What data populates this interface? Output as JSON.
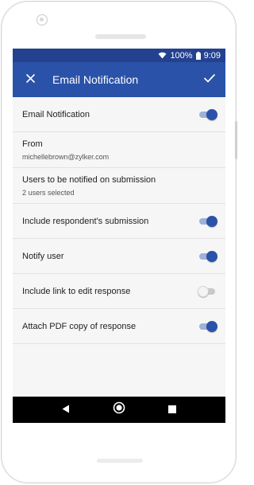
{
  "status_bar": {
    "battery_percent": "100%",
    "time": "9:09",
    "icons": [
      "wifi-icon",
      "battery-icon"
    ]
  },
  "app_bar": {
    "title": "Email Notification",
    "close_icon": "close-icon",
    "confirm_icon": "check-icon"
  },
  "settings": [
    {
      "label": "Email Notification",
      "type": "toggle",
      "enabled": true
    },
    {
      "label": "From",
      "type": "value",
      "value": "michellebrown@zylker.com"
    },
    {
      "label": "Users to be notified on submission",
      "type": "value",
      "value": "2 users selected"
    },
    {
      "label": "Include respondent's submission",
      "type": "toggle",
      "enabled": true
    },
    {
      "label": "Notify user",
      "type": "toggle",
      "enabled": true
    },
    {
      "label": "Include link to edit response",
      "type": "toggle",
      "enabled": false
    },
    {
      "label": "Attach PDF copy of response",
      "type": "toggle",
      "enabled": true
    }
  ],
  "nav_bar": {
    "buttons": [
      "back-icon",
      "home-icon",
      "recents-icon"
    ]
  },
  "colors": {
    "status_bar": "#24418f",
    "app_bar": "#2a52a8",
    "toggle_on": "#2a52a8",
    "toggle_on_track": "#9fb1d9",
    "toggle_off_track": "#c9c9c9",
    "nav_bar": "#000000"
  }
}
